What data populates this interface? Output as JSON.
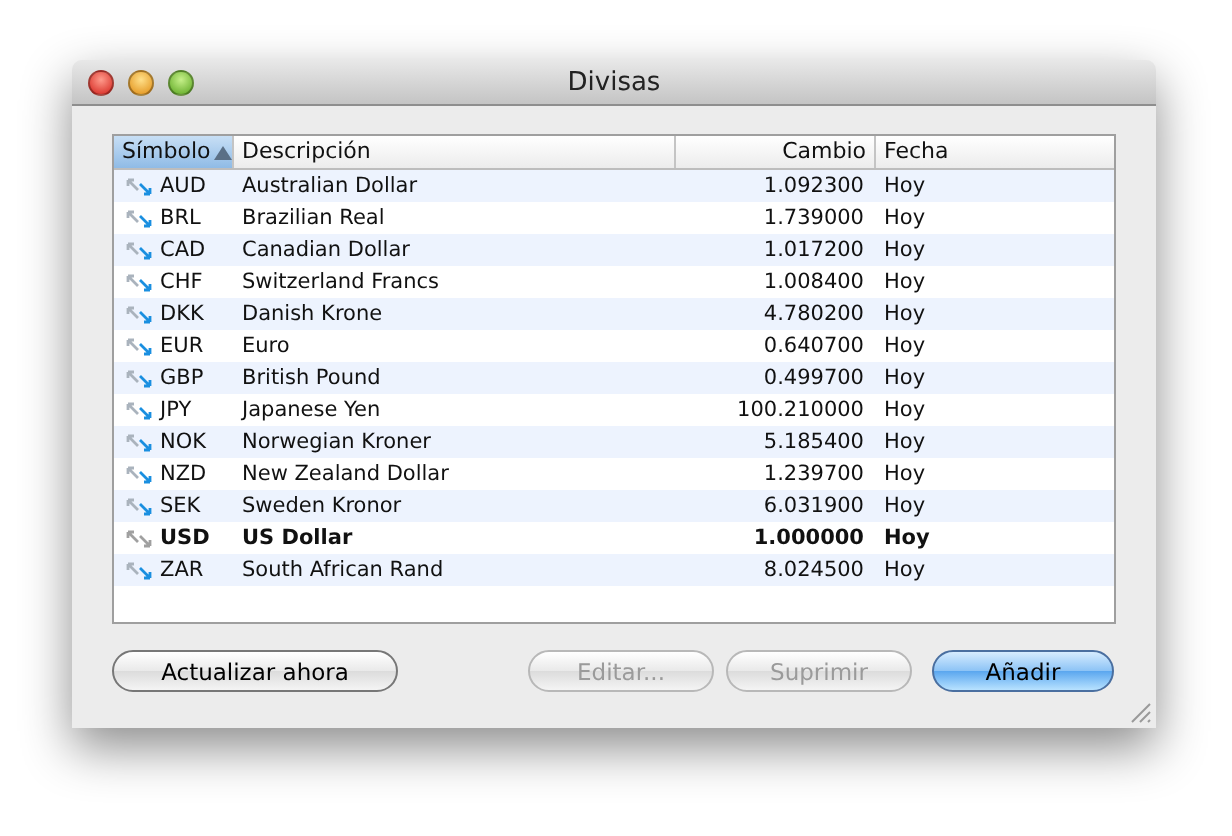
{
  "window": {
    "title": "Divisas"
  },
  "table": {
    "columns": [
      {
        "label": "Símbolo",
        "sorted": true
      },
      {
        "label": "Descripción",
        "sorted": false
      },
      {
        "label": "Cambio",
        "sorted": false
      },
      {
        "label": "Fecha",
        "sorted": false
      }
    ],
    "rows": [
      {
        "symbol": "AUD",
        "description": "Australian Dollar",
        "rate": "1.092300",
        "date": "Hoy",
        "base": false
      },
      {
        "symbol": "BRL",
        "description": "Brazilian Real",
        "rate": "1.739000",
        "date": "Hoy",
        "base": false
      },
      {
        "symbol": "CAD",
        "description": "Canadian Dollar",
        "rate": "1.017200",
        "date": "Hoy",
        "base": false
      },
      {
        "symbol": "CHF",
        "description": "Switzerland Francs",
        "rate": "1.008400",
        "date": "Hoy",
        "base": false
      },
      {
        "symbol": "DKK",
        "description": "Danish Krone",
        "rate": "4.780200",
        "date": "Hoy",
        "base": false
      },
      {
        "symbol": "EUR",
        "description": "Euro",
        "rate": "0.640700",
        "date": "Hoy",
        "base": false
      },
      {
        "symbol": "GBP",
        "description": "British Pound",
        "rate": "0.499700",
        "date": "Hoy",
        "base": false
      },
      {
        "symbol": "JPY",
        "description": "Japanese Yen",
        "rate": "100.210000",
        "date": "Hoy",
        "base": false
      },
      {
        "symbol": "NOK",
        "description": "Norwegian Kroner",
        "rate": "5.185400",
        "date": "Hoy",
        "base": false
      },
      {
        "symbol": "NZD",
        "description": "New Zealand Dollar",
        "rate": "1.239700",
        "date": "Hoy",
        "base": false
      },
      {
        "symbol": "SEK",
        "description": "Sweden Kronor",
        "rate": "6.031900",
        "date": "Hoy",
        "base": false
      },
      {
        "symbol": "USD",
        "description": "US Dollar",
        "rate": "1.000000",
        "date": "Hoy",
        "base": true
      },
      {
        "symbol": "ZAR",
        "description": "South African Rand",
        "rate": "8.024500",
        "date": "Hoy",
        "base": false
      }
    ]
  },
  "buttons": [
    {
      "label": "Actualizar ahora",
      "disabled": false,
      "default": false
    },
    {
      "label": "Editar...",
      "disabled": true,
      "default": false
    },
    {
      "label": "Suprimir",
      "disabled": true,
      "default": false
    },
    {
      "label": "Añadir",
      "disabled": false,
      "default": true
    }
  ]
}
